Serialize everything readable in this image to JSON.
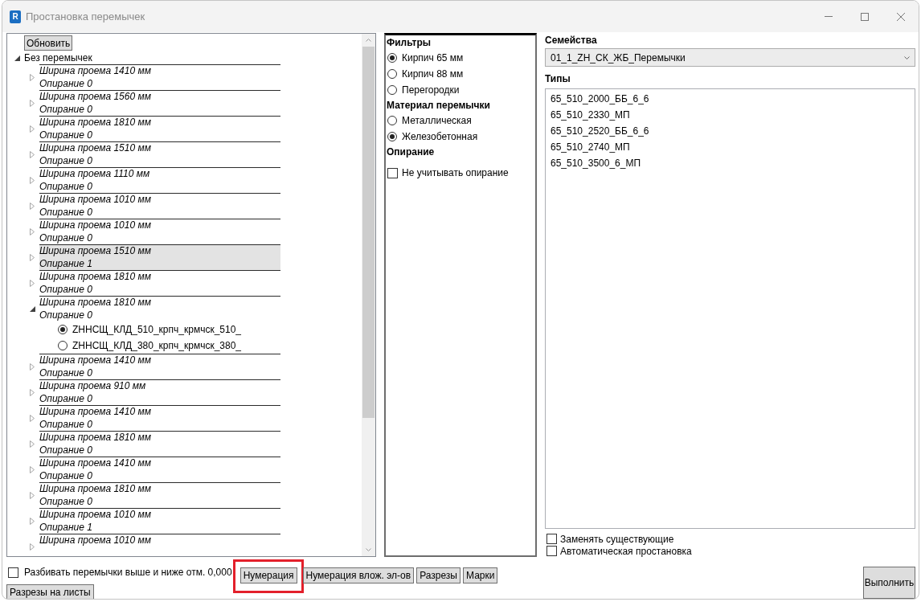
{
  "window": {
    "title": "Простановка перемычек",
    "icon_text": "R"
  },
  "tree_panel": {
    "refresh_button": "Обновить",
    "nodes": [
      {
        "label": "Без перемычек",
        "expanded": true,
        "selected": false,
        "children": [
          {
            "opening": "Ширина проема 1410 мм",
            "support": "Опирание 0",
            "expanded": false,
            "selected": false
          },
          {
            "opening": "Ширина проема 1560 мм",
            "support": "Опирание 0",
            "expanded": false,
            "selected": false
          },
          {
            "opening": "Ширина проема 1810 мм",
            "support": "Опирание 0",
            "expanded": false,
            "selected": false
          },
          {
            "opening": "Ширина проема 1510 мм",
            "support": "Опирание 0",
            "expanded": false,
            "selected": false
          },
          {
            "opening": "Ширина проема 1110 мм",
            "support": "Опирание 0",
            "expanded": false,
            "selected": false
          },
          {
            "opening": "Ширина проема 1010 мм",
            "support": "Опирание 0",
            "expanded": false,
            "selected": false
          },
          {
            "opening": "Ширина проема 1010 мм",
            "support": "Опирание 0",
            "expanded": false,
            "selected": false
          },
          {
            "opening": "Ширина проема 1510 мм",
            "support": "Опирание 1",
            "expanded": false,
            "selected": true
          },
          {
            "opening": "Ширина проема 1810 мм",
            "support": "Опирание 0",
            "expanded": false,
            "selected": false
          },
          {
            "opening": "Ширина проема 1810 мм",
            "support": "Опирание 0",
            "expanded": true,
            "selected": false,
            "children": [
              {
                "kind": "radio",
                "label": "ZHНСЩ_КЛД_510_крпч_крмчск_510_",
                "selected": true
              },
              {
                "kind": "radio",
                "label": "ZHНСЩ_КЛД_380_крпч_крмчск_380_",
                "selected": false
              }
            ]
          },
          {
            "opening": "Ширина проема 1410 мм",
            "support": "Опирание 0",
            "expanded": false,
            "selected": false
          },
          {
            "opening": "Ширина проема 910 мм",
            "support": "Опирание 0",
            "expanded": false,
            "selected": false
          },
          {
            "opening": "Ширина проема 1410 мм",
            "support": "Опирание 0",
            "expanded": false,
            "selected": false
          },
          {
            "opening": "Ширина проема 1810 мм",
            "support": "Опирание 0",
            "expanded": false,
            "selected": false
          },
          {
            "opening": "Ширина проема 1410 мм",
            "support": "Опирание 0",
            "expanded": false,
            "selected": false
          },
          {
            "opening": "Ширина проема 1810 мм",
            "support": "Опирание 0",
            "expanded": false,
            "selected": false
          },
          {
            "opening": "Ширина проема 1010 мм",
            "support": "Опирание 1",
            "expanded": false,
            "selected": false
          },
          {
            "opening": "Ширина проема 1010 мм",
            "expanded": false,
            "selected": false
          }
        ]
      }
    ]
  },
  "filters_panel": {
    "sections": [
      {
        "title": "Фильтры",
        "options": [
          {
            "kind": "radio",
            "label": "Кирпич 65 мм",
            "selected": true
          },
          {
            "kind": "radio",
            "label": "Кирпич 88 мм",
            "selected": false
          },
          {
            "kind": "radio",
            "label": "Перегородки",
            "selected": false
          }
        ]
      },
      {
        "title": "Материал перемычки",
        "options": [
          {
            "kind": "radio",
            "label": "Металлическая",
            "selected": false
          },
          {
            "kind": "radio",
            "label": "Железобетонная",
            "selected": true
          }
        ]
      },
      {
        "title": "Опирание",
        "options": [
          {
            "kind": "checkbox",
            "label": "Не учитывать опирание",
            "checked": false
          }
        ]
      }
    ]
  },
  "families": {
    "label": "Семейства",
    "value": "01_1_ZH_СК_ЖБ_Перемычки"
  },
  "types": {
    "label": "Типы",
    "items": [
      {
        "label": "65_510_2000_ББ_6_6",
        "selected": false
      },
      {
        "label": "65_510_2330_МП",
        "selected": false
      },
      {
        "label": "65_510_2520_ББ_6_6",
        "selected": false
      },
      {
        "label": "65_510_2740_МП",
        "selected": false
      },
      {
        "label": "65_510_3500_6_МП",
        "selected": false
      }
    ]
  },
  "options": [
    {
      "label": "Заменять существующие",
      "checked": false
    },
    {
      "label": "Автоматическая простановка",
      "checked": false
    }
  ],
  "bottom_bar": {
    "split_checkbox": {
      "label": "Разбивать перемычки выше и ниже отм. 0,000",
      "checked": false
    },
    "buttons": [
      {
        "label": "Нумерация",
        "highlighted": true
      },
      {
        "label": "Нумерация влож. эл-ов",
        "highlighted": false
      },
      {
        "label": "Разрезы",
        "highlighted": false
      },
      {
        "label": "Марки",
        "highlighted": false
      },
      {
        "label": "Разрезы на листы",
        "highlighted": false
      }
    ],
    "run_button": "Выполнить"
  }
}
